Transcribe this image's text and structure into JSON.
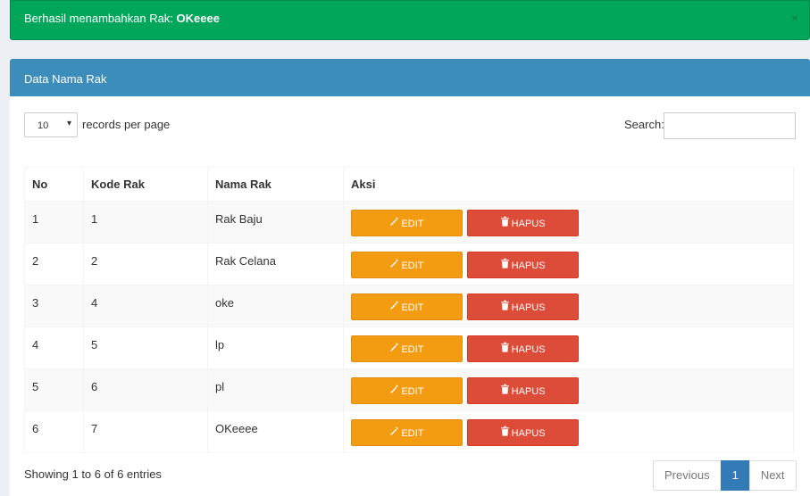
{
  "alert": {
    "message": "Berhasil menambahkan Rak:",
    "highlight": "OKeeee",
    "close_glyph": "×"
  },
  "box": {
    "title": "Data Nama Rak"
  },
  "controls": {
    "length_value": "10",
    "length_caret": "▾",
    "length_label": "records per page",
    "search_label": "Search:",
    "search_value": ""
  },
  "table": {
    "headers": [
      "No",
      "Kode Rak",
      "Nama Rak",
      "Aksi"
    ],
    "rows": [
      {
        "no": "1",
        "kode": "1",
        "nama": "Rak Baju"
      },
      {
        "no": "2",
        "kode": "2",
        "nama": "Rak Celana"
      },
      {
        "no": "3",
        "kode": "4",
        "nama": "oke"
      },
      {
        "no": "4",
        "kode": "5",
        "nama": "lp"
      },
      {
        "no": "5",
        "kode": "6",
        "nama": "pl"
      },
      {
        "no": "6",
        "kode": "7",
        "nama": "OKeeee"
      }
    ],
    "edit_label": "EDIT",
    "delete_label": "HAPUS",
    "edit_icon": "pencil-icon",
    "delete_icon": "trash-icon"
  },
  "footer": {
    "info": "Showing 1 to 6 of 6 entries",
    "prev": "Previous",
    "current": "1",
    "next": "Next"
  },
  "colors": {
    "success": "#00a65a",
    "primary": "#3c8dbc",
    "warning": "#f39c12",
    "danger": "#dd4b39"
  }
}
